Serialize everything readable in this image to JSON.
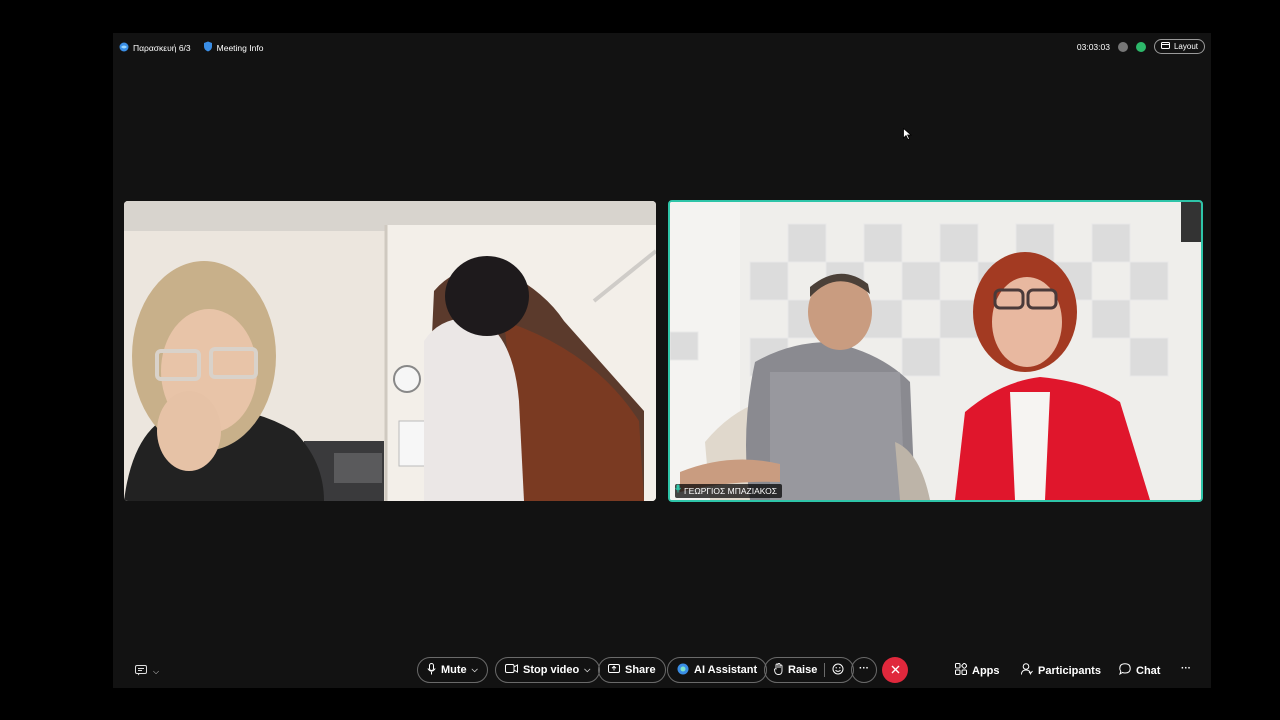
{
  "topbar": {
    "date_label": "Παρασκευή 6/3",
    "meeting_info_label": "Meeting Info",
    "timer": "03:03:03",
    "layout_label": "Layout"
  },
  "participants": {
    "tile2_name": "ΓΕΩΡΓΙΟΣ ΜΠΑΖΙΑΚΟΣ"
  },
  "toolbar": {
    "mute_label": "Mute",
    "stop_video_label": "Stop video",
    "share_label": "Share",
    "ai_assistant_label": "AI Assistant",
    "raise_label": "Raise",
    "more_label": "···",
    "apps_label": "Apps",
    "participants_label": "Participants",
    "chat_label": "Chat",
    "overflow_label": "···"
  },
  "colors": {
    "accent_border": "#2ec4a8",
    "end_call": "#e0283c",
    "webex_blue": "#3a8ee6"
  }
}
